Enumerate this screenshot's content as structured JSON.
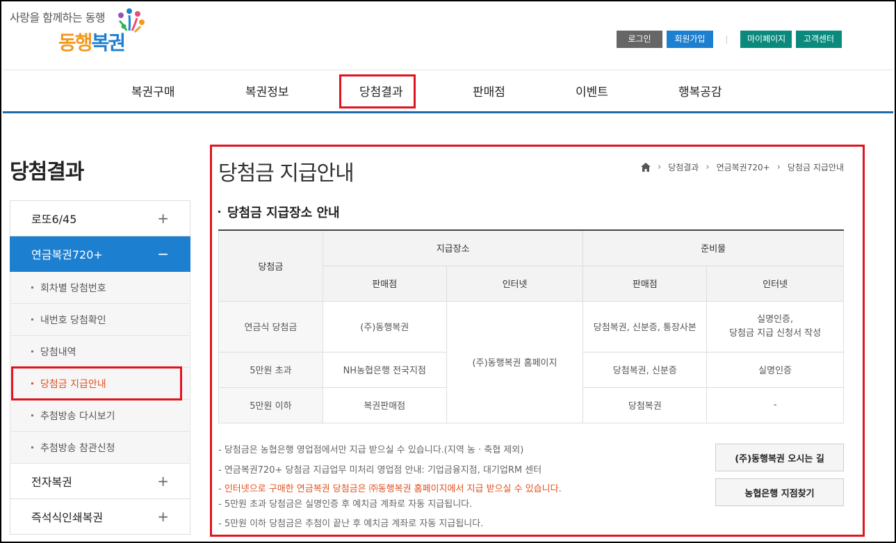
{
  "header": {
    "tagline": "사랑을 함께하는 동행",
    "logo_orange": "동행",
    "logo_blue": "복권",
    "util": {
      "login": "로그인",
      "join": "회원가입",
      "mypage": "마이페이지",
      "cs": "고객센터"
    }
  },
  "gnb": [
    "복권구매",
    "복권정보",
    "당첨결과",
    "판매점",
    "이벤트",
    "행복공감"
  ],
  "sidebar": {
    "title": "당첨결과",
    "menu": [
      {
        "label": "로또6/45",
        "sign": "+"
      },
      {
        "label": "연금복권720+",
        "sign": "−"
      },
      {
        "label": "전자복권",
        "sign": "+"
      },
      {
        "label": "즉석식인쇄복권",
        "sign": "+"
      }
    ],
    "sub": [
      "회차별 당첨번호",
      "내번호 당첨확인",
      "당첨내역",
      "당첨금 지급안내",
      "추첨방송 다시보기",
      "추첨방송 참관신청"
    ]
  },
  "content": {
    "title": "당첨금 지급안내",
    "breadcrumb": [
      "당첨결과",
      "연금복권720+",
      "당첨금 지급안내"
    ],
    "section_title": "당첨금 지급장소 안내",
    "table": {
      "h_prize": "당첨금",
      "h_place": "지급장소",
      "h_prep": "준비물",
      "h_store": "판매점",
      "h_internet": "인터넷",
      "rows": [
        {
          "prize": "연금식 당첨금",
          "store": "(주)동행복권",
          "prep_store": "당첨복권, 신분증, 통장사본",
          "prep_net_1": "실명인증,",
          "prep_net_2": "당첨금 지급 신청서 작성"
        },
        {
          "prize": "5만원 초과",
          "store": "NH농협은행 전국지점",
          "prep_store": "당첨복권, 신분증",
          "prep_net": "실명인증"
        },
        {
          "prize": "5만원 이하",
          "store": "복권판매점",
          "prep_store": "당첨복권",
          "prep_net": "-"
        }
      ],
      "internet_place": "(주)동행복권 홈페이지"
    },
    "notes": [
      "-  당첨금은 농협은행 영업점에서만 지급 받으실 수 있습니다.(지역 농 · 축협 제외)",
      "-  연금복권720+ 당첨금 지급업무 미처리 영업점 안내: 기업금융지점, 대기업RM 센터",
      "-  인터넷으로 구매한 연금복권 당첨금은 ㈜동행복권 홈페이지에서 지급 받으실 수 있습니다.",
      "-  5만원 초과 당첨금은 실명인증 후 예치금 계좌로 자동 지급됩니다.",
      "-  5만원 이하 당첨금은 추첨이 끝난 후 예치금 계좌로 자동 지급됩니다."
    ],
    "buttons": {
      "directions": "(주)동행복권 오시는 길",
      "nh_branch": "농협은행 지점찾기"
    }
  },
  "colors": {
    "accent_blue": "#1d7fd0",
    "highlight_red": "#e0141e",
    "note_red": "#e0501e",
    "teal": "#0a8a7c"
  }
}
